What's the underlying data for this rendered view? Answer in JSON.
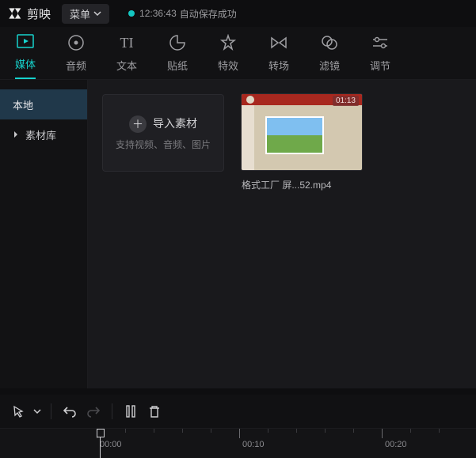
{
  "titlebar": {
    "app_name": "剪映",
    "menu_label": "菜单",
    "autosave_time": "12:36:43",
    "autosave_text": "自动保存成功"
  },
  "tabs": [
    {
      "id": "media",
      "label": "媒体"
    },
    {
      "id": "audio",
      "label": "音频"
    },
    {
      "id": "text",
      "label": "文本"
    },
    {
      "id": "sticker",
      "label": "贴纸"
    },
    {
      "id": "effect",
      "label": "特效"
    },
    {
      "id": "transition",
      "label": "转场"
    },
    {
      "id": "filter",
      "label": "滤镜"
    },
    {
      "id": "adjust",
      "label": "调节"
    }
  ],
  "active_tab": "media",
  "sidebar": {
    "items": [
      {
        "id": "local",
        "label": "本地",
        "selected": true
      },
      {
        "id": "library",
        "label": "素材库",
        "expandable": true
      }
    ]
  },
  "import": {
    "title": "导入素材",
    "subtitle": "支持视频、音频、图片"
  },
  "clips": [
    {
      "name": "格式工厂 屏...52.mp4",
      "badge": "01:13"
    }
  ],
  "toolbar": {
    "select": "select-tool",
    "undo": "undo",
    "redo": "redo",
    "split": "split",
    "delete": "delete"
  },
  "timeline": {
    "labels": [
      "00:00",
      "00:10",
      "00:20"
    ]
  }
}
